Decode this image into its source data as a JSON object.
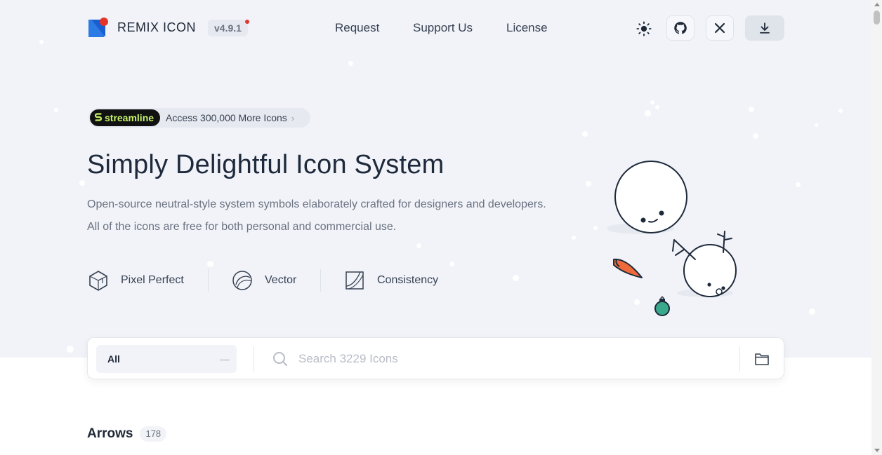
{
  "header": {
    "logo_text": "REMIX ICON",
    "version": "v4.9.1",
    "nav": [
      "Request",
      "Support Us",
      "License"
    ],
    "icons": {
      "theme": "sun-icon",
      "github": "github-icon",
      "x": "x-icon",
      "download": "download-icon"
    }
  },
  "promo": {
    "brand": "streamline",
    "text": "Access 300,000 More Icons"
  },
  "hero": {
    "title": "Simply Delightful Icon System",
    "description_line1": "Open-source neutral-style system symbols elaborately crafted for designers and developers.",
    "description_line2": "All of the icons are free for both personal and commercial use.",
    "features": [
      "Pixel Perfect",
      "Vector",
      "Consistency"
    ]
  },
  "search": {
    "category_selected": "All",
    "placeholder": "Search 3229 Icons"
  },
  "section": {
    "title": "Arrows",
    "count": "178"
  },
  "colors": {
    "accent_blue": "#2c7be5",
    "accent_red": "#e5352b",
    "streamline_green": "#c6f26a",
    "hero_bg": "#f1f3f9"
  }
}
